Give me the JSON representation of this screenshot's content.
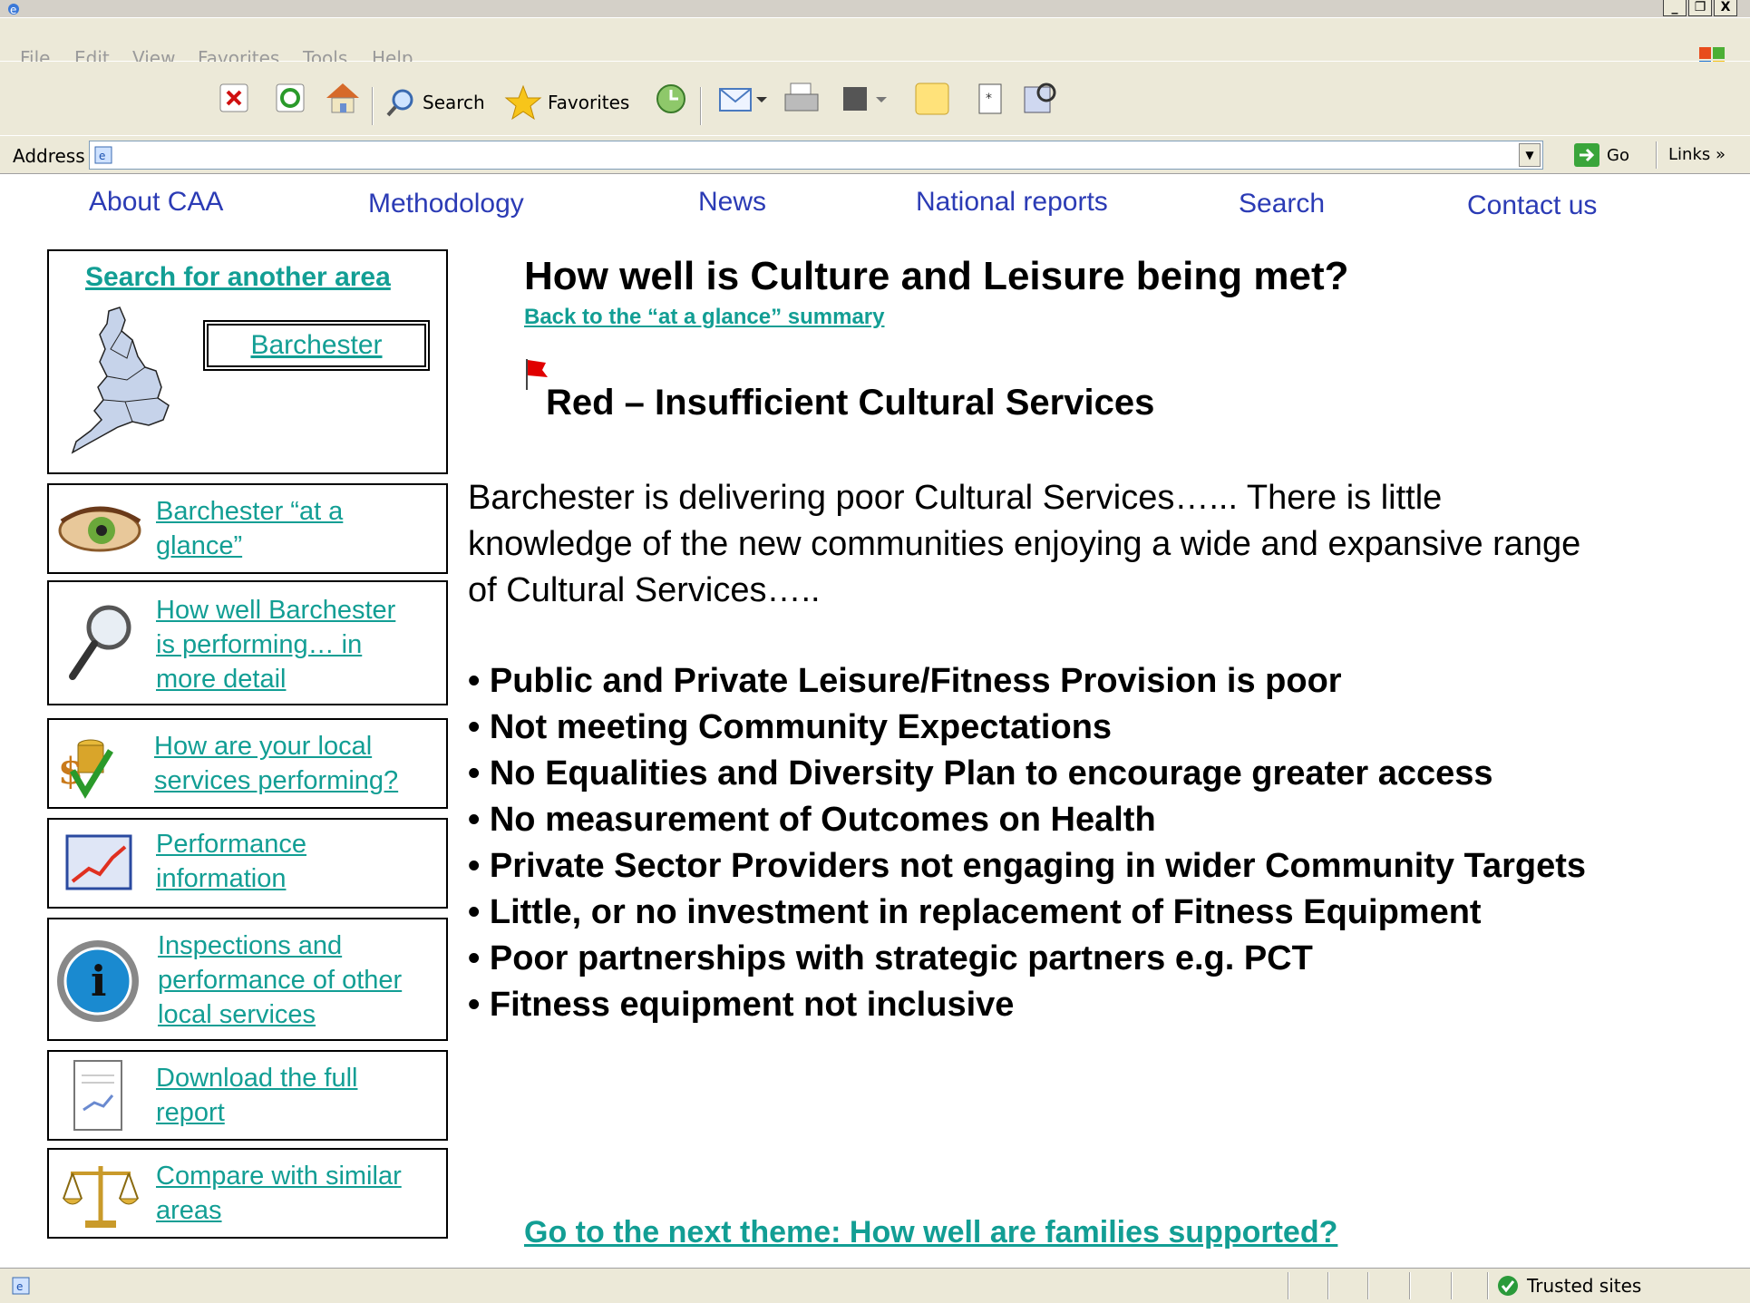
{
  "browser": {
    "menu": [
      "File",
      "Edit",
      "View",
      "Favorites",
      "Tools",
      "Help"
    ],
    "toolbar": {
      "search": "Search",
      "favorites": "Favorites"
    },
    "address": {
      "label": "Address",
      "value": "",
      "go": "Go",
      "links": "Links"
    },
    "window_buttons": [
      "_",
      "❐",
      "X"
    ],
    "status": {
      "zone": "Trusted sites"
    }
  },
  "nav": [
    "About CAA",
    "Methodology",
    "News",
    "National reports",
    "Search",
    "Contact us"
  ],
  "sidebar": {
    "search_title": "Search for another area",
    "area_name": "Barchester",
    "links": [
      {
        "line1": "Barchester “at a",
        "line2": "glance”",
        "icon": "eye-icon"
      },
      {
        "line1": "How well Barchester",
        "line2": "is performing… in",
        "line3": "more detail",
        "icon": "magnifier-icon"
      },
      {
        "line1": "How are your local",
        "line2": "services performing?",
        "icon": "coins-check-icon"
      },
      {
        "line1": "Performance",
        "line2": "information",
        "icon": "chart-icon"
      },
      {
        "line1": "Inspections and",
        "line2": "performance of other",
        "line3": "local services",
        "icon": "info-icon"
      },
      {
        "line1": "Download the full",
        "line2": "report",
        "icon": "document-icon"
      },
      {
        "line1": "Compare with similar",
        "line2": "areas",
        "icon": "scales-icon"
      }
    ]
  },
  "main": {
    "title": "How well is Culture and Leisure being met?",
    "back_link": "Back to the “at a glance” summary",
    "rating": "Red – Insufficient Cultural Services",
    "paragraph": [
      "Barchester is delivering poor Cultural Services…... There is little",
      "knowledge of the new communities enjoying a wide and expansive range",
      "of Cultural Services….."
    ],
    "bullets": [
      "• Public and Private Leisure/Fitness Provision is poor",
      "• Not meeting Community Expectations",
      "• No Equalities and Diversity Plan to encourage greater access",
      "• No measurement of Outcomes on Health",
      "• Private Sector Providers not engaging in wider Community Targets",
      "• Little, or no investment in replacement of Fitness Equipment",
      "• Poor partnerships with strategic partners e.g. PCT",
      "• Fitness equipment not inclusive"
    ],
    "next_theme": "Go to the next theme: How well are families supported?"
  },
  "colors": {
    "link_teal": "#129e94",
    "nav_blue": "#2b3bb5",
    "flag_red": "#e00000"
  }
}
